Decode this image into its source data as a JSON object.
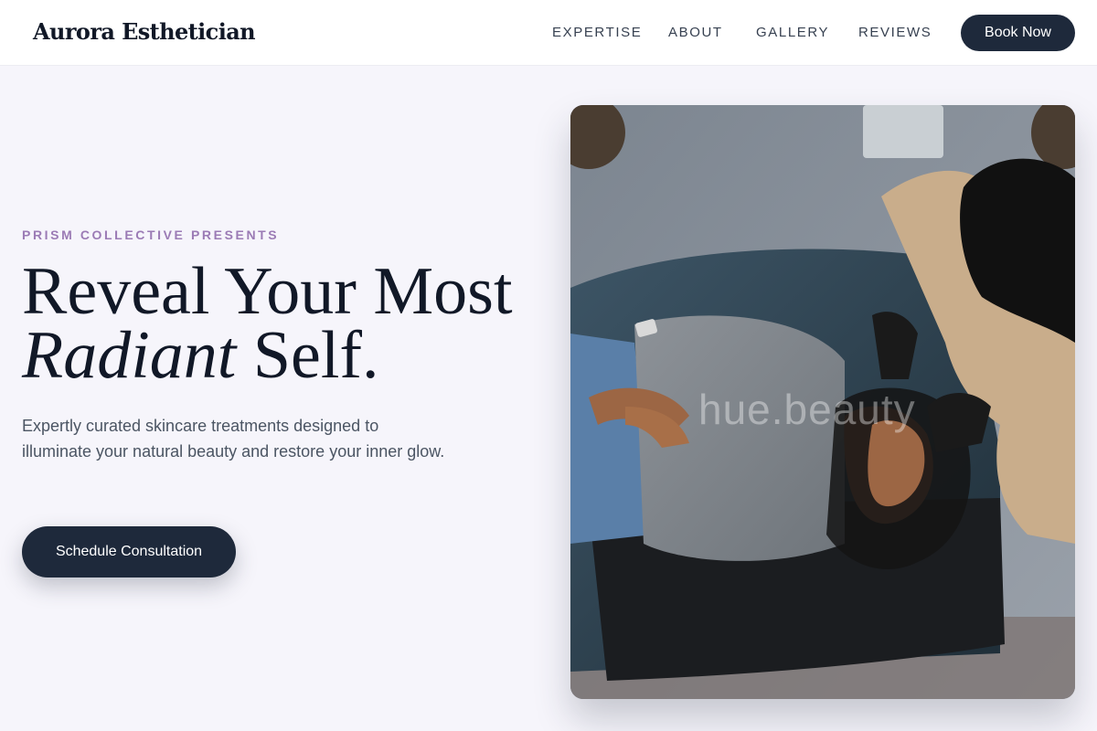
{
  "header": {
    "brand": "Aurora Esthetician",
    "nav": [
      {
        "label": "EXPERTISE"
      },
      {
        "label": "ABOUT"
      },
      {
        "label": "GALLERY"
      },
      {
        "label": "REVIEWS"
      }
    ],
    "book_label": "Book Now"
  },
  "hero": {
    "eyebrow": "PRISM COLLECTIVE PRESENTS",
    "headline_line1": "Reveal Your Most",
    "headline_italic": "Radiant",
    "headline_rest": " Self.",
    "subtext": "Expertly curated skincare treatments designed to illuminate your natural beauty and restore your inner glow.",
    "cta_label": "Schedule Consultation",
    "image_watermark": "hue.beauty"
  },
  "colors": {
    "background": "#f6f5fb",
    "primary_dark": "#1e293b",
    "accent_purple": "#9b7bb5"
  }
}
